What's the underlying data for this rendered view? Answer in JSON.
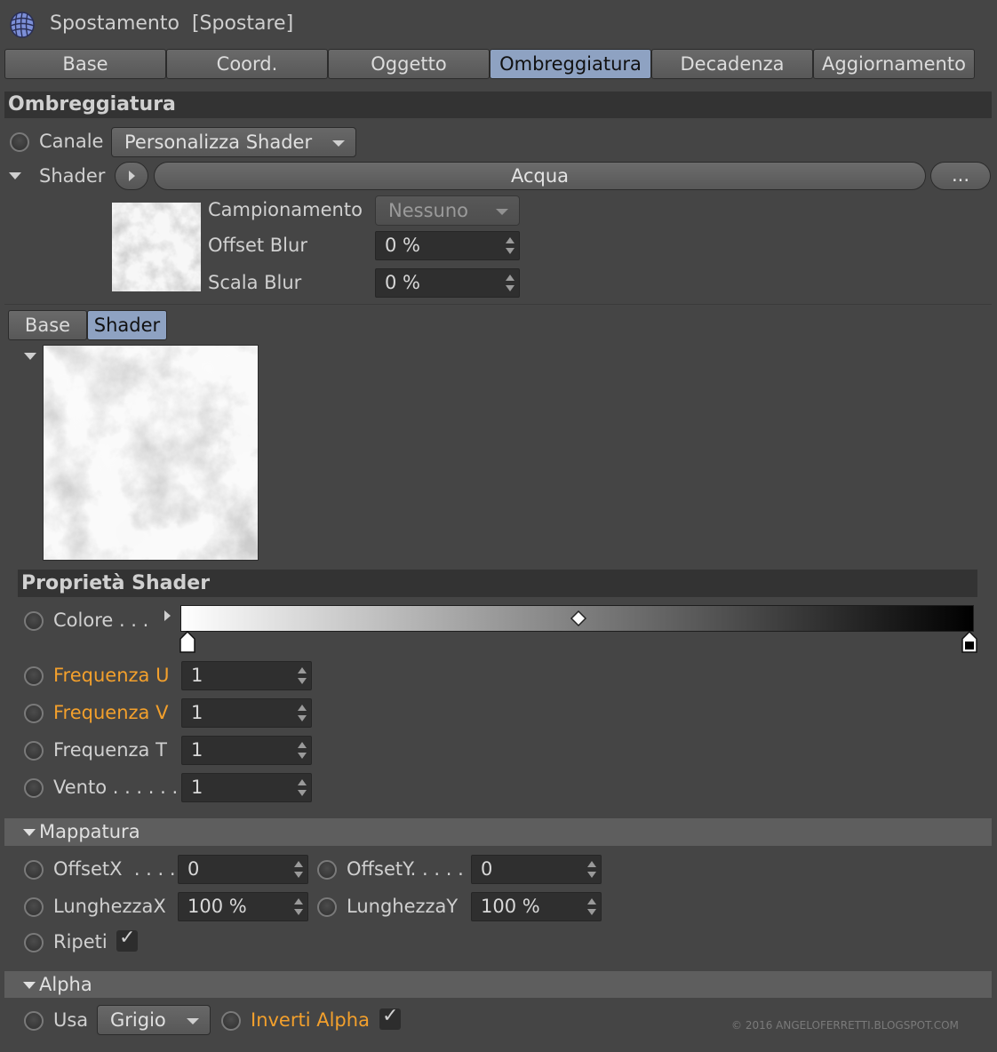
{
  "window": {
    "title": "Spostamento  [Spostare]"
  },
  "tabs": [
    {
      "label": "Base"
    },
    {
      "label": "Coord."
    },
    {
      "label": "Oggetto"
    },
    {
      "label": "Ombreggiatura",
      "active": true
    },
    {
      "label": "Decadenza"
    },
    {
      "label": "Aggiornamento"
    }
  ],
  "section_title": "Ombreggiatura",
  "canale": {
    "label": "Canale",
    "value": "Personalizza Shader"
  },
  "shader": {
    "label": "Shader",
    "name": "Acqua",
    "more_button": "..."
  },
  "preview_params": {
    "campionamento": {
      "label": "Campionamento",
      "value": "Nessuno"
    },
    "offset_blur": {
      "label": "Offset Blur",
      "value": "0 %"
    },
    "scala_blur": {
      "label": "Scala Blur",
      "value": "0 %"
    }
  },
  "subtabs": [
    {
      "label": "Base"
    },
    {
      "label": "Shader",
      "active": true
    }
  ],
  "shader_props": {
    "title": "Proprietà Shader",
    "colore": {
      "label": "Colore . . .",
      "gradient_start": "#ffffff",
      "gradient_end": "#000000"
    },
    "freq_u": {
      "label": "Frequenza U",
      "value": "1"
    },
    "freq_v": {
      "label": "Frequenza V",
      "value": "1"
    },
    "freq_t": {
      "label": "Frequenza T",
      "value": "1"
    },
    "vento": {
      "label": "Vento . . . . . .",
      "value": "1"
    }
  },
  "mappatura": {
    "title": "Mappatura",
    "offset_x": {
      "label": "OffsetX  . . . .",
      "value": "0"
    },
    "offset_y": {
      "label": "OffsetY. . . . .",
      "value": "0"
    },
    "lunghezza_x": {
      "label": "LunghezzaX",
      "value": "100 %"
    },
    "lunghezza_y": {
      "label": "LunghezzaY",
      "value": "100 %"
    },
    "ripeti": {
      "label": "Ripeti",
      "checked": true
    }
  },
  "alpha": {
    "title": "Alpha",
    "usa": {
      "label": "Usa",
      "value": "Grigio"
    },
    "inverti": {
      "label": "Inverti Alpha",
      "checked": true
    }
  },
  "watermark": "© 2016 ANGELOFERRETTI.BLOGSPOT.COM",
  "colors": {
    "accent_tab": "#8ea2c2",
    "highlight_label": "#f3a02c",
    "background": "#454545"
  }
}
